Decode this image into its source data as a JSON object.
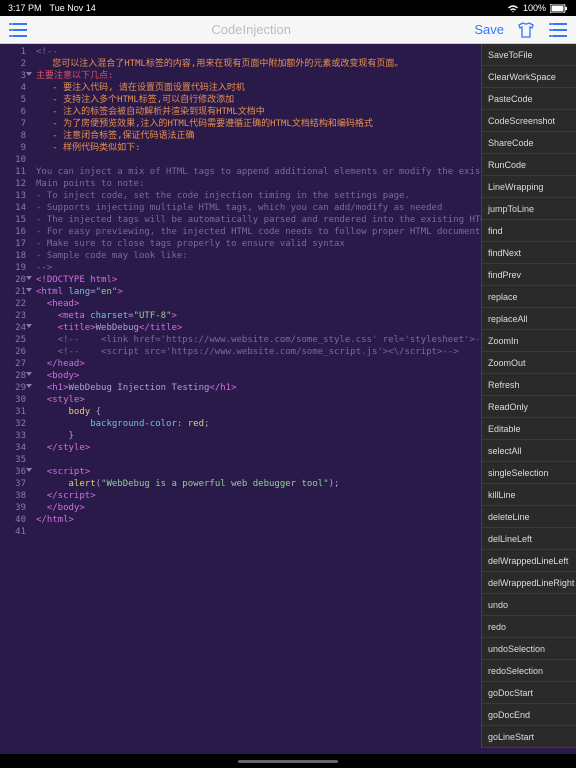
{
  "status": {
    "time": "3:17 PM",
    "date": "Tue Nov 14",
    "battery": "100%",
    "wifi": "●"
  },
  "toolbar": {
    "title": "CodeInjection",
    "save": "Save"
  },
  "dropdown": {
    "items": [
      "SaveToFile",
      "ClearWorkSpace",
      "PasteCode",
      "CodeScreenshot",
      "ShareCode",
      "RunCode",
      "LineWrapping",
      "jumpToLine",
      "find",
      "findNext",
      "findPrev",
      "replace",
      "replaceAll",
      "ZoomIn",
      "ZoomOut",
      "Refresh",
      "ReadOnly",
      "Editable",
      "selectAll",
      "singleSelection",
      "killLine",
      "deleteLine",
      "delLineLeft",
      "delWrappedLineLeft",
      "delWrappedLineRight",
      "undo",
      "redo",
      "undoSelection",
      "redoSelection",
      "goDocStart",
      "goDocEnd",
      "goLineStart"
    ]
  },
  "gutter": {
    "start": 1,
    "end": 41,
    "folds": [
      3,
      20,
      21,
      24,
      28,
      29,
      36
    ]
  },
  "code": {
    "lines": [
      {
        "cls": "c-comment",
        "t": "<!--"
      },
      {
        "cls": "c-orange",
        "t": "   您可以注入混合了HTML标签的内容,用来在现有页面中附加额外的元素或改变现有页面。"
      },
      {
        "cls": "c-red",
        "t": "主要注意以下几点:"
      },
      {
        "cls": "c-orange",
        "t": "   - 要注入代码, 请在设置页面设置代码注入时机"
      },
      {
        "cls": "c-orange",
        "t": "   - 支持注入多个HTML标签,可以自行修改添加"
      },
      {
        "cls": "c-orange",
        "t": "   - 注入的标签会被自动解析并渲染到现有HTML文档中"
      },
      {
        "cls": "c-orange",
        "t": "   - 为了房便预览效果,注入的HTML代码需要遵循正确的HTML文档结构和编码格式"
      },
      {
        "cls": "c-orange",
        "t": "   - 注意闭合标签,保证代码语法正确"
      },
      {
        "cls": "c-orange",
        "t": "   - 样例代码类似如下:"
      },
      {
        "cls": "c-comment",
        "t": ""
      },
      {
        "cls": "c-comment",
        "t": "You can inject a mix of HTML tags to append additional elements or modify the existing page."
      },
      {
        "cls": "c-comment",
        "t": "Main points to note:"
      },
      {
        "cls": "c-comment",
        "t": "- To inject code, set the code injection timing in the settings page."
      },
      {
        "cls": "c-comment",
        "t": "- Supports injecting multiple HTML tags, which you can add/modify as needed"
      },
      {
        "cls": "c-comment",
        "t": "- The injected tags will be automatically parsed and rendered into the existing HTML document"
      },
      {
        "cls": "c-comment",
        "t": "- For easy previewing, the injected HTML code needs to follow proper HTML document structure and encod"
      },
      {
        "cls": "c-comment",
        "t": "- Make sure to close tags properly to ensure valid syntax"
      },
      {
        "cls": "c-comment",
        "t": "- Sample code may look like:"
      },
      {
        "cls": "c-comment",
        "t": "-->"
      },
      {
        "cls": "",
        "html": "<span class='c-tag'>&lt;!DOCTYPE html&gt;</span>"
      },
      {
        "cls": "",
        "html": "<span class='c-tag'>&lt;html</span> <span class='c-attr'>lang</span>=<span class='c-string'>\"en\"</span><span class='c-tag'>&gt;</span>"
      },
      {
        "cls": "",
        "html": "  <span class='c-tag'>&lt;head&gt;</span>"
      },
      {
        "cls": "",
        "html": "    <span class='c-tag'>&lt;meta</span> <span class='c-attr'>charset</span>=<span class='c-string'>\"UTF-8\"</span><span class='c-tag'>&gt;</span>"
      },
      {
        "cls": "",
        "html": "    <span class='c-tag'>&lt;title&gt;</span>WebDebug<span class='c-tag'>&lt;/title&gt;</span>"
      },
      {
        "cls": "c-comment",
        "t": "    <!--    <link href='https://www.website.com/some_style.css' rel='stylesheet'>-->"
      },
      {
        "cls": "c-comment",
        "t": "    <!--    <script src='https://www.website.com/some_script.js'><\\/script>-->"
      },
      {
        "cls": "",
        "html": "  <span class='c-tag'>&lt;/head&gt;</span>"
      },
      {
        "cls": "",
        "html": "  <span class='c-tag'>&lt;body&gt;</span>"
      },
      {
        "cls": "",
        "html": "  <span class='c-tag'>&lt;h1&gt;</span>WebDebug Injection Testing<span class='c-tag'>&lt;/h1&gt;</span>"
      },
      {
        "cls": "",
        "html": "  <span class='c-tag'>&lt;style&gt;</span>"
      },
      {
        "cls": "",
        "html": "      <span class='c-keyword'>body</span> {"
      },
      {
        "cls": "",
        "html": "          <span class='c-attr'>background-color</span>: <span class='c-keyword'>red</span>;"
      },
      {
        "cls": "",
        "t": "      }"
      },
      {
        "cls": "",
        "html": "  <span class='c-tag'>&lt;/style&gt;</span>"
      },
      {
        "cls": "",
        "t": ""
      },
      {
        "cls": "",
        "html": "  <span class='c-tag'>&lt;script&gt;</span>"
      },
      {
        "cls": "",
        "html": "      <span class='c-keyword'>alert</span>(<span class='c-string'>\"WebDebug is a powerful web debugger tool\"</span>);"
      },
      {
        "cls": "",
        "html": "  <span class='c-tag'>&lt;/script&gt;</span>"
      },
      {
        "cls": "",
        "html": "  <span class='c-tag'>&lt;/body&gt;</span>"
      },
      {
        "cls": "",
        "html": "<span class='c-tag'>&lt;/html&gt;</span>"
      },
      {
        "cls": "",
        "t": ""
      }
    ]
  }
}
